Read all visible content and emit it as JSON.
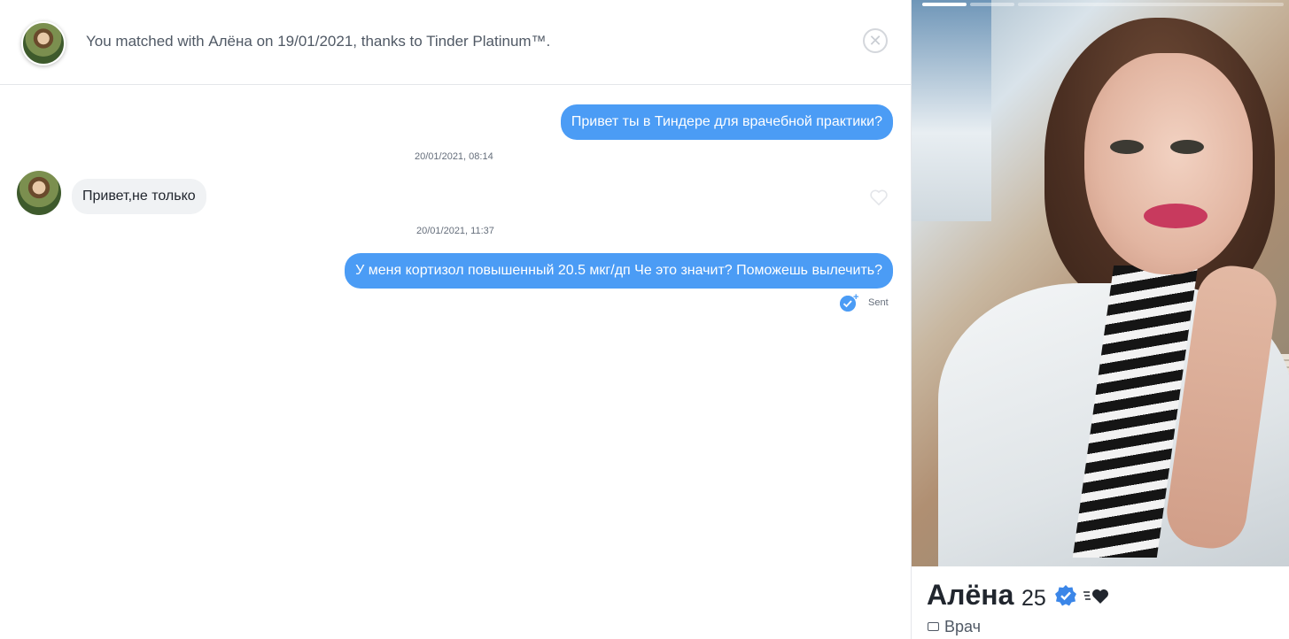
{
  "header": {
    "match_text": "You matched with Алёна on 19/01/2021, thanks to Tinder Platinum™.",
    "close_icon": "close-icon"
  },
  "messages": [
    {
      "direction": "out",
      "text": "Привет ты в Тиндере для врачебной практики?"
    },
    {
      "direction": "in",
      "text": "Привет,не только",
      "timestamp": "20/01/2021, 08:14"
    },
    {
      "direction": "out",
      "text": "У меня кортизол повышенный 20.5 мкг/дп Че это значит? Поможешь вылечить?",
      "timestamp": "20/01/2021, 11:37",
      "status": "Sent"
    }
  ],
  "profile": {
    "name": "Алёна",
    "age": "25",
    "job": "Врач",
    "verified_icon": "verified-badge-icon",
    "photo_count": 3,
    "current_photo": 1
  },
  "colors": {
    "accent": "#4b9cf5",
    "bubble_in": "#f0f2f4",
    "text": "#21262e",
    "muted": "#656e7b"
  }
}
